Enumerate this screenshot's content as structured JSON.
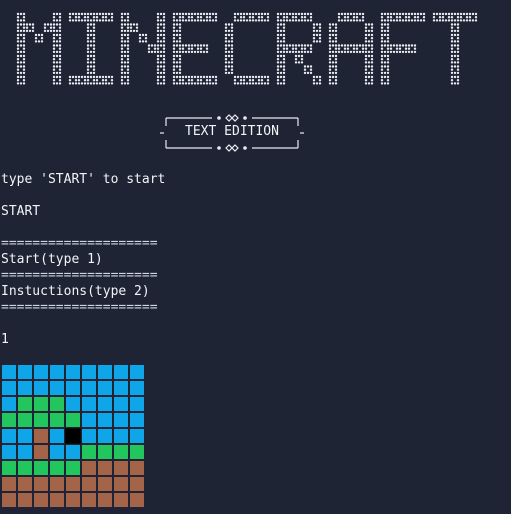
{
  "title_art": {
    "text": "MINECRAFT",
    "subtitle": "TEXT EDITION",
    "dot_color": "#e8ebf2"
  },
  "console": {
    "lines": [
      "type 'START' to start",
      "START",
      "====================",
      "Start(type 1)",
      "====================",
      "Instuctions(type 2)",
      "====================",
      "1"
    ]
  },
  "world": {
    "colors": {
      "S": "#0ea5e9",
      "G": "#22c55e",
      "D": "#a3644a",
      "P": "#000000"
    },
    "rows": [
      "SSSSSSSSS",
      "SSSSSSSSS",
      "SGGGSSSSS",
      "GGGGGSSSS",
      "SSDSPSSSS",
      "SSDSSGGGG",
      "GGGGGDDDD",
      "DDDDDDDDD",
      "DDDDDDDDD"
    ]
  }
}
